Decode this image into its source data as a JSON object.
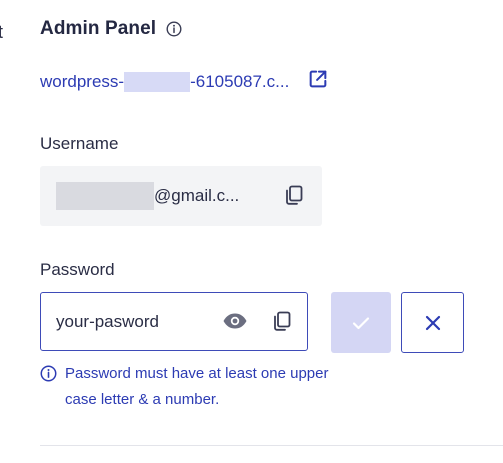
{
  "edge_mark": "t",
  "header": {
    "title": "Admin Panel",
    "info_icon": "info-circle-icon"
  },
  "site_link": {
    "prefix": "wordpress-",
    "suffix": "-6105087.c...",
    "external_icon": "external-link-icon"
  },
  "username": {
    "label": "Username",
    "value_suffix": "@gmail.c...",
    "copy_icon": "copy-icon"
  },
  "password": {
    "label": "Password",
    "value": "your-pasword",
    "eye_icon": "eye-icon",
    "copy_icon": "copy-icon",
    "confirm_icon": "check-icon",
    "cancel_icon": "close-icon",
    "hint": "Password must have at least one upper case letter & a number."
  },
  "colors": {
    "accent": "#2c3bb3",
    "confirm_disabled_bg": "#d4d6f4",
    "field_bg": "#f3f4f6",
    "redaction": "#d7daf6"
  }
}
